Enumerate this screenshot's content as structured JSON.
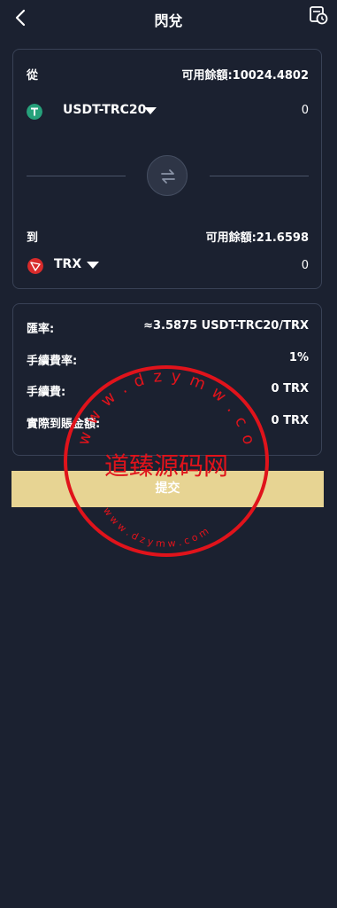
{
  "header": {
    "title": "閃兌",
    "back_icon": "chevron-left-icon",
    "history_icon": "history-icon"
  },
  "from": {
    "label": "從",
    "balance": "可用餘額:10024.4802",
    "coin": "USDT-TRC20",
    "coin_icon": "tether-icon",
    "coin_color": "#26a17b",
    "amount": "0"
  },
  "swap": {
    "icon": "swap-arrows-icon"
  },
  "to": {
    "label": "到",
    "balance": "可用餘額:21.6598",
    "coin": "TRX",
    "coin_icon": "tron-icon",
    "coin_color": "#d82b2b",
    "amount": "0"
  },
  "info": {
    "rows": [
      {
        "label": "匯率:",
        "value": "≈3.5875 USDT-TRC20/TRX"
      },
      {
        "label": "手續費率:",
        "value": "1%"
      },
      {
        "label": "手續費:",
        "value": "0 TRX"
      },
      {
        "label": "實際到賬金額:",
        "value": "0 TRX"
      }
    ]
  },
  "submit": {
    "label": "提交",
    "color": "#e7d493"
  },
  "watermark": {
    "text": "道臻源码网",
    "url_top": "w w w . d z y m w . c o m",
    "url_bottom": "w w w . d z y m w . c o m",
    "color": "#e0131b"
  }
}
